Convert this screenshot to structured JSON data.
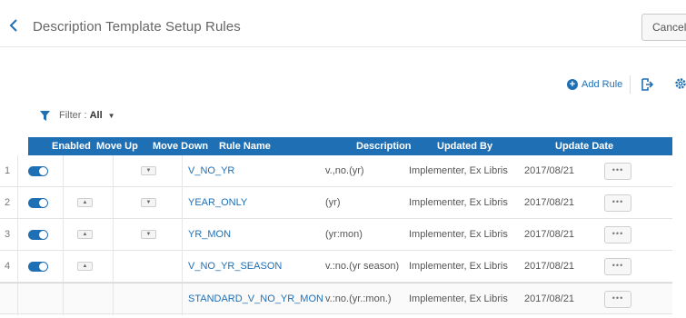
{
  "header": {
    "title": "Description Template Setup Rules",
    "cancel_label": "Cancel"
  },
  "toolbar": {
    "add_rule_label": "Add Rule"
  },
  "filter": {
    "label": "Filter :",
    "value": "All"
  },
  "table": {
    "columns": [
      "Enabled",
      "Move Up",
      "Move Down",
      "Rule Name",
      "Description",
      "Updated By",
      "Update Date"
    ],
    "rows": [
      {
        "num": "1",
        "name": "V_NO_YR",
        "description": "v.,no.(yr)",
        "updated_by": "Implementer, Ex Libris",
        "date": "2017/08/21",
        "more": "•••"
      },
      {
        "num": "2",
        "name": "YEAR_ONLY",
        "description": "(yr)",
        "updated_by": "Implementer, Ex Libris",
        "date": "2017/08/21",
        "more": "•••"
      },
      {
        "num": "3",
        "name": "YR_MON",
        "description": "(yr:mon)",
        "updated_by": "Implementer, Ex Libris",
        "date": "2017/08/21",
        "more": "•••"
      },
      {
        "num": "4",
        "name": "V_NO_YR_SEASON",
        "description": "v.:no.(yr season)",
        "updated_by": "Implementer, Ex Libris",
        "date": "2017/08/21",
        "more": "•••"
      },
      {
        "num": "",
        "name": "STANDARD_V_NO_YR_MON",
        "description": "v.:no.(yr.:mon.)",
        "updated_by": "Implementer, Ex Libris",
        "date": "2017/08/21",
        "more": "•••"
      }
    ]
  },
  "colors": {
    "accent": "#1f6fb5",
    "header_bg": "#1f6fb5"
  }
}
